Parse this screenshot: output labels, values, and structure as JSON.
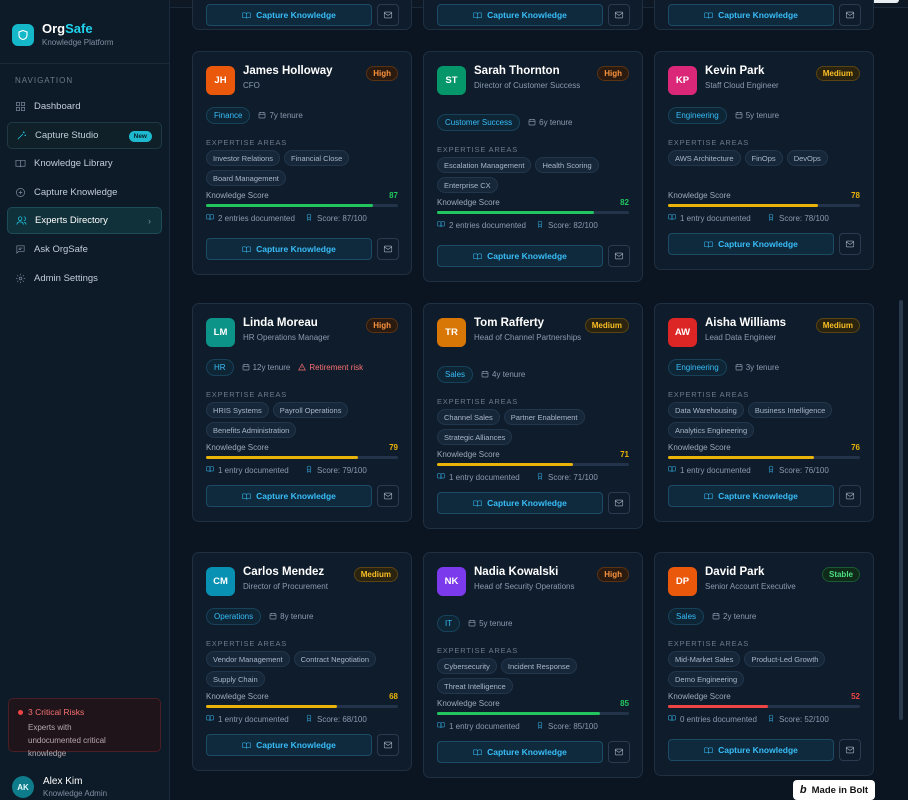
{
  "brand": {
    "name_main": "Org",
    "name_accent": "Safe",
    "subtitle": "Knowledge Platform"
  },
  "nav": {
    "heading": "NAVIGATION",
    "items": [
      {
        "label": "Dashboard",
        "icon": "grid-icon"
      },
      {
        "label": "Capture Studio",
        "icon": "wand-icon",
        "badge": "New"
      },
      {
        "label": "Knowledge Library",
        "icon": "book-icon"
      },
      {
        "label": "Capture Knowledge",
        "icon": "plus-circle-icon"
      },
      {
        "label": "Experts Directory",
        "icon": "users-icon",
        "active": true
      },
      {
        "label": "Ask OrgSafe",
        "icon": "chat-icon"
      },
      {
        "label": "Admin Settings",
        "icon": "gear-icon"
      }
    ]
  },
  "risk": {
    "title": "3 Critical Risks",
    "description": "Experts with undocumented critical knowledge"
  },
  "user": {
    "initials": "AK",
    "name": "Alex Kim",
    "role": "Knowledge Admin"
  },
  "common": {
    "expertise_heading": "EXPERTISE AREAS",
    "score_label": "Knowledge Score",
    "capture_label": "Capture Knowledge"
  },
  "colors": {
    "accent": "#22d3ee",
    "high": "#fb923c",
    "medium": "#fbbf24",
    "stable": "#4ade80",
    "score_green": "#22c55e",
    "score_yellow": "#eab308",
    "score_red": "#ef4444"
  },
  "experts": [
    {
      "initials": "JH",
      "avatar_color": "#ea580c",
      "name": "James Holloway",
      "role": "CFO",
      "priority": "High",
      "dept": "Finance",
      "tenure": "7y tenure",
      "retirement": "",
      "tags": [
        "Investor Relations",
        "Financial Close",
        "Board Management"
      ],
      "score": 87,
      "entries": "2 entries documented",
      "score_text": "Score: 87/100"
    },
    {
      "initials": "ST",
      "avatar_color": "#059669",
      "name": "Sarah Thornton",
      "role": "Director of Customer Success",
      "priority": "High",
      "dept": "Customer Success",
      "tenure": "6y tenure",
      "retirement": "",
      "tags": [
        "Escalation Management",
        "Health Scoring",
        "Enterprise CX"
      ],
      "score": 82,
      "entries": "2 entries documented",
      "score_text": "Score: 82/100"
    },
    {
      "initials": "KP",
      "avatar_color": "#db2777",
      "name": "Kevin Park",
      "role": "Staff Cloud Engineer",
      "priority": "Medium",
      "dept": "Engineering",
      "tenure": "5y tenure",
      "retirement": "",
      "tags": [
        "AWS Architecture",
        "FinOps",
        "DevOps"
      ],
      "score": 78,
      "entries": "1 entry documented",
      "score_text": "Score: 78/100"
    },
    {
      "initials": "LM",
      "avatar_color": "#0d9488",
      "name": "Linda Moreau",
      "role": "HR Operations Manager",
      "priority": "High",
      "dept": "HR",
      "tenure": "12y tenure",
      "retirement": "Retirement risk",
      "tags": [
        "HRIS Systems",
        "Payroll Operations",
        "Benefits Administration"
      ],
      "score": 79,
      "entries": "1 entry documented",
      "score_text": "Score: 79/100"
    },
    {
      "initials": "TR",
      "avatar_color": "#d97706",
      "name": "Tom Rafferty",
      "role": "Head of Channel Partnerships",
      "priority": "Medium",
      "dept": "Sales",
      "tenure": "4y tenure",
      "retirement": "",
      "tags": [
        "Channel Sales",
        "Partner Enablement",
        "Strategic Alliances"
      ],
      "score": 71,
      "entries": "1 entry documented",
      "score_text": "Score: 71/100"
    },
    {
      "initials": "AW",
      "avatar_color": "#dc2626",
      "name": "Aisha Williams",
      "role": "Lead Data Engineer",
      "priority": "Medium",
      "dept": "Engineering",
      "tenure": "3y tenure",
      "retirement": "",
      "tags": [
        "Data Warehousing",
        "Business Intelligence",
        "Analytics Engineering"
      ],
      "score": 76,
      "entries": "1 entry documented",
      "score_text": "Score: 76/100"
    },
    {
      "initials": "CM",
      "avatar_color": "#0891b2",
      "name": "Carlos Mendez",
      "role": "Director of Procurement",
      "priority": "Medium",
      "dept": "Operations",
      "tenure": "8y tenure",
      "retirement": "",
      "tags": [
        "Vendor Management",
        "Contract Negotiation",
        "Supply Chain"
      ],
      "score": 68,
      "entries": "1 entry documented",
      "score_text": "Score: 68/100"
    },
    {
      "initials": "NK",
      "avatar_color": "#7c3aed",
      "name": "Nadia Kowalski",
      "role": "Head of Security Operations",
      "priority": "High",
      "dept": "IT",
      "tenure": "5y tenure",
      "retirement": "",
      "tags": [
        "Cybersecurity",
        "Incident Response",
        "Threat Intelligence"
      ],
      "score": 85,
      "entries": "1 entry documented",
      "score_text": "Score: 85/100"
    },
    {
      "initials": "DP",
      "avatar_color": "#ea580c",
      "name": "David Park",
      "role": "Senior Account Executive",
      "priority": "Stable",
      "dept": "Sales",
      "tenure": "2y tenure",
      "retirement": "",
      "tags": [
        "Mid-Market Sales",
        "Product-Led Growth",
        "Demo Engineering"
      ],
      "score": 52,
      "entries": "0 entries documented",
      "score_text": "Score: 52/100"
    }
  ],
  "top_row_capture": [
    "Capture Knowledge",
    "Capture Knowledge",
    "Capture Knowledge"
  ],
  "made_in": "Made in Bolt"
}
